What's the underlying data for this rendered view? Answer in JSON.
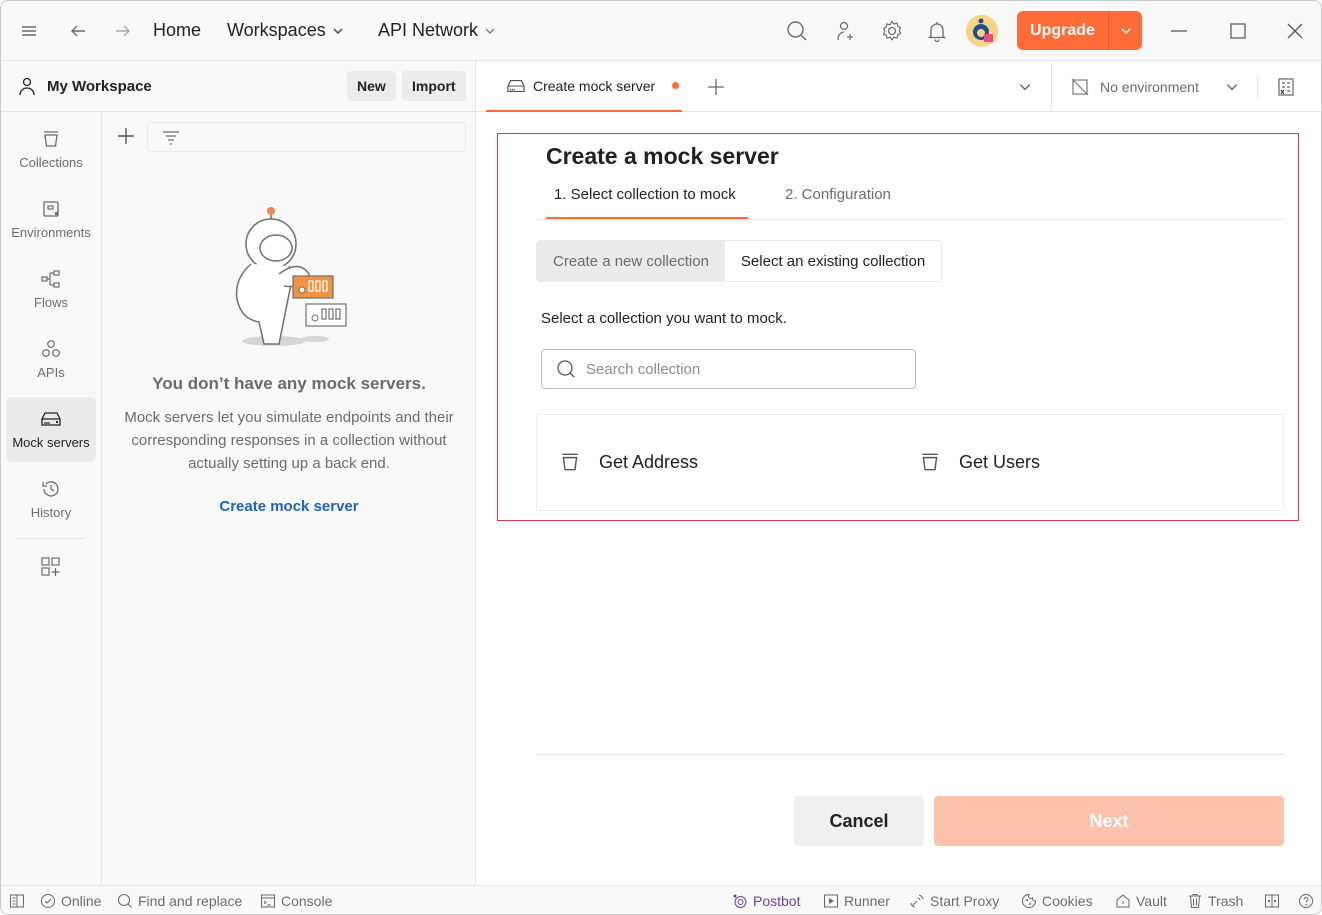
{
  "titlebar": {
    "nav": {
      "home": "Home",
      "workspaces": "Workspaces",
      "api_network": "API Network"
    },
    "upgrade_label": "Upgrade",
    "accent": "#ff6c37"
  },
  "workspace": {
    "title": "My Workspace",
    "new_label": "New",
    "import_label": "Import"
  },
  "rail": {
    "items": [
      {
        "label": "Collections",
        "icon": "collections-icon",
        "active": false
      },
      {
        "label": "Environments",
        "icon": "environments-icon",
        "active": false
      },
      {
        "label": "Flows",
        "icon": "flows-icon",
        "active": false
      },
      {
        "label": "APIs",
        "icon": "apis-icon",
        "active": false
      },
      {
        "label": "Mock servers",
        "icon": "mock-servers-icon",
        "active": true
      },
      {
        "label": "History",
        "icon": "history-icon",
        "active": false
      }
    ]
  },
  "panel": {
    "empty_title": "You don’t have any mock servers.",
    "empty_desc": "Mock servers let you simulate endpoints and their corresponding responses in a collection without actually setting up a back end.",
    "create_link": "Create mock server"
  },
  "tabs": {
    "active_tab": "Create mock server",
    "unsaved": true,
    "environment": "No environment"
  },
  "main": {
    "title": "Create a mock server",
    "steps": [
      "1.  Select collection to mock",
      "2. Configuration"
    ],
    "segment": {
      "new": "Create a new collection",
      "existing": "Select an existing collection",
      "selected": "existing"
    },
    "prompt": "Select a collection you want to mock.",
    "search_placeholder": "Search collection",
    "collections": [
      "Get Address",
      "Get Users"
    ],
    "cancel_label": "Cancel",
    "next_label": "Next"
  },
  "statusbar": {
    "online": "Online",
    "find_replace": "Find and replace",
    "console": "Console",
    "postbot": "Postbot",
    "runner": "Runner",
    "start_proxy": "Start Proxy",
    "cookies": "Cookies",
    "vault": "Vault",
    "trash": "Trash"
  }
}
